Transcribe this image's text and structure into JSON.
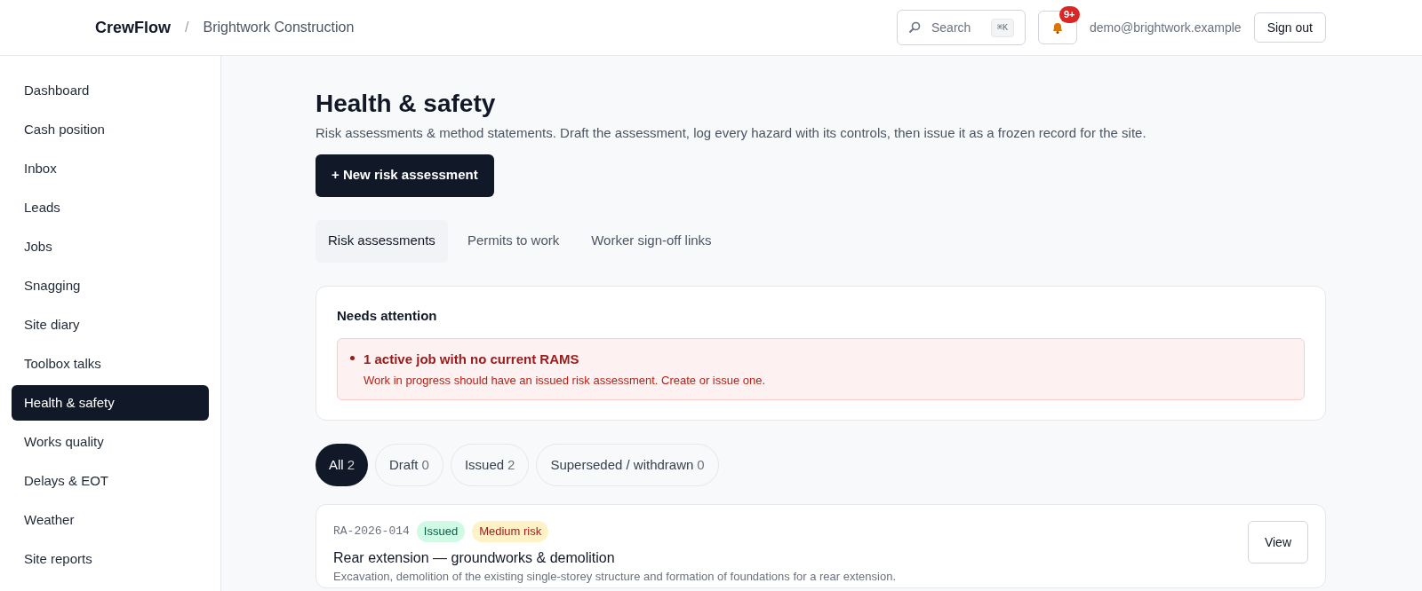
{
  "header": {
    "brand": "CrewFlow",
    "separator": "/",
    "organization": "Brightwork Construction",
    "search": {
      "placeholder": "Search",
      "shortcut": "⌘K"
    },
    "notifications": {
      "badge": "9+"
    },
    "user_email": "demo@brightwork.example",
    "sign_out": "Sign out"
  },
  "sidebar": {
    "items": [
      {
        "label": "Dashboard",
        "selected": false
      },
      {
        "label": "Cash position",
        "selected": false
      },
      {
        "label": "Inbox",
        "selected": false
      },
      {
        "label": "Leads",
        "selected": false
      },
      {
        "label": "Jobs",
        "selected": false
      },
      {
        "label": "Snagging",
        "selected": false
      },
      {
        "label": "Site diary",
        "selected": false
      },
      {
        "label": "Toolbox talks",
        "selected": false
      },
      {
        "label": "Health & safety",
        "selected": true
      },
      {
        "label": "Works quality",
        "selected": false
      },
      {
        "label": "Delays & EOT",
        "selected": false
      },
      {
        "label": "Weather",
        "selected": false
      },
      {
        "label": "Site reports",
        "selected": false
      }
    ]
  },
  "page": {
    "title": "Health & safety",
    "description": "Risk assessments & method statements. Draft the assessment, log every hazard with its controls, then issue it as a frozen record for the site.",
    "new_button": "+ New risk assessment"
  },
  "tabs": [
    {
      "label": "Risk assessments",
      "selected": true
    },
    {
      "label": "Permits to work",
      "selected": false
    },
    {
      "label": "Worker sign-off links",
      "selected": false
    }
  ],
  "attention": {
    "title": "Needs attention",
    "alerts": [
      {
        "title": "1 active job with no current RAMS",
        "detail": "Work in progress should have an issued risk assessment. Create or issue one."
      }
    ]
  },
  "filters": [
    {
      "label": "All",
      "count": "2",
      "selected": true
    },
    {
      "label": "Draft",
      "count": "0",
      "selected": false
    },
    {
      "label": "Issued",
      "count": "2",
      "selected": false
    },
    {
      "label": "Superseded / withdrawn",
      "count": "0",
      "selected": false
    }
  ],
  "assessments": [
    {
      "ref": "RA-2026-014",
      "tags": [
        {
          "label": "Issued",
          "kind": "status"
        },
        {
          "label": "Medium risk",
          "kind": "risk"
        }
      ],
      "title": "Rear extension — groundworks & demolition",
      "description": "Excavation, demolition of the existing single-storey structure and formation of foundations for a rear extension.",
      "action": "View"
    }
  ]
}
